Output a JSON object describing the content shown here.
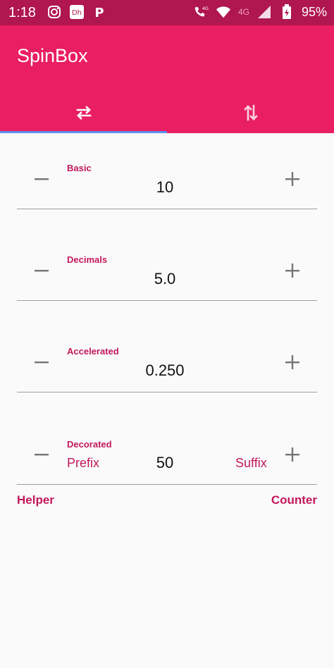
{
  "status_bar": {
    "time": "1:18",
    "signal_label_1": "4G",
    "signal_label_2": "4G",
    "battery": "95%"
  },
  "app": {
    "title": "SpinBox",
    "tabs": [
      {
        "icon": "swap-horizontal-icon"
      },
      {
        "icon": "swap-vertical-icon"
      }
    ],
    "selected_tab": 0
  },
  "fields": [
    {
      "label": "Basic",
      "value": "10"
    },
    {
      "label": "Decimals",
      "value": "5.0"
    },
    {
      "label": "Accelerated",
      "value": "0.250"
    },
    {
      "label": "Decorated",
      "value": "50",
      "prefix": "Prefix",
      "suffix": "Suffix"
    }
  ],
  "helper_text": "Helper",
  "counter_text": "Counter",
  "colors": {
    "primary": "#e91e63",
    "status_bar": "#b0164f",
    "accent_label": "#c2185b",
    "tab_indicator": "#5c8ef2"
  }
}
